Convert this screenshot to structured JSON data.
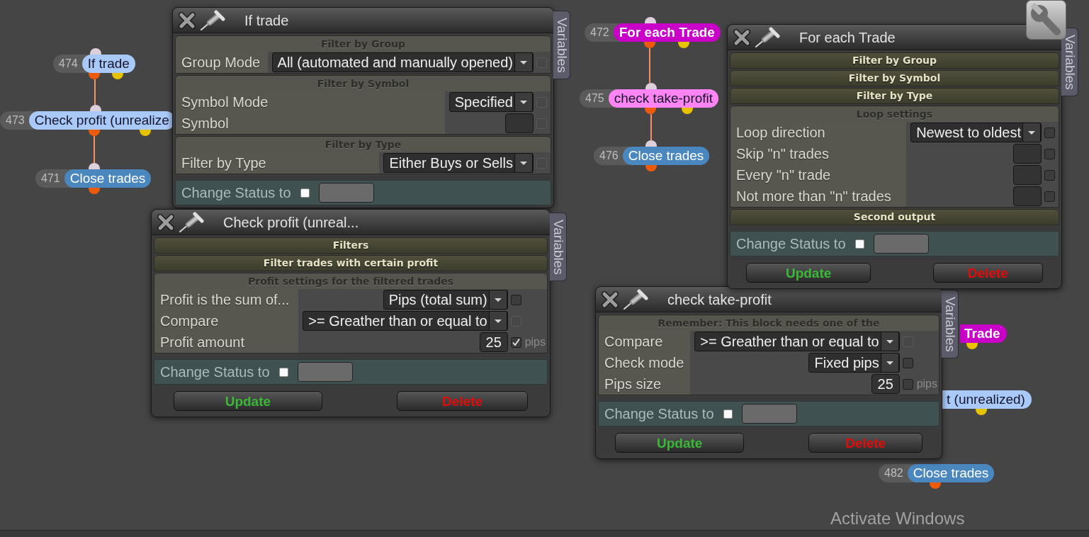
{
  "canvas": {
    "nodes": [
      {
        "number": "474",
        "label": "If trade",
        "kind": "condition",
        "color": "#a9c9f9",
        "input_port": true,
        "output_port": true,
        "second_output_port": true
      },
      {
        "number": "473",
        "label": "Check profit (unrealize",
        "kind": "condition",
        "color": "#a9c9f9",
        "input_port": true,
        "output_port": true,
        "second_output_port": true
      },
      {
        "number": "471",
        "label": "Close trades",
        "kind": "action",
        "color": "#4a87bf",
        "input_port": true,
        "output_port": true
      },
      {
        "number": "472",
        "label": "For each Trade",
        "kind": "loop",
        "color": "#c800c8",
        "input_port": true,
        "output_port": true,
        "second_output_port": true
      },
      {
        "number": "475",
        "label": "check take-profit",
        "kind": "condition",
        "color": "#ff85f5",
        "input_port": true,
        "output_port": true,
        "second_output_port": true
      },
      {
        "number": "476",
        "label": "Close trades",
        "kind": "action",
        "color": "#4a87bf",
        "input_port": true,
        "output_port": true
      },
      {
        "label": "Trade",
        "kind": "loop",
        "color": "#c800c8",
        "second_output_port": true
      },
      {
        "label": "t (unrealized)",
        "kind": "condition",
        "color": "#a9c9f9",
        "second_output_port": true
      },
      {
        "number": "482",
        "label": "Close trades",
        "kind": "action",
        "color": "#4a87bf",
        "output_port": true
      }
    ]
  },
  "panels": [
    {
      "title": "If trade",
      "variables_tab": "Variables",
      "sections": [
        {
          "title": "Filter by Group",
          "expanded": true,
          "rows": [
            {
              "label": "Group Mode",
              "kind": "select",
              "value": "All (automated and manually opened)",
              "checkbox": {
                "checked": false,
                "disabled": true
              }
            }
          ]
        },
        {
          "title": "Filter by Symbol",
          "expanded": true,
          "rows": [
            {
              "label": "Symbol Mode",
              "kind": "select",
              "value": "Specified",
              "checkbox": {
                "checked": false,
                "disabled": true
              }
            },
            {
              "label": "Symbol",
              "kind": "input",
              "checkbox": {
                "checked": false,
                "disabled": true
              }
            }
          ]
        },
        {
          "title": "Filter by Type",
          "expanded": true,
          "rows": [
            {
              "label": "Filter by Type",
              "kind": "select",
              "value": "Either Buys or Sells",
              "checkbox": {
                "checked": false,
                "disabled": true
              }
            }
          ]
        }
      ],
      "change_status": {
        "label": "Change Status to",
        "checked": false
      }
    },
    {
      "title": "Check profit (unreal...",
      "variables_tab": "Variables",
      "sections": [
        {
          "title": "Filters",
          "expanded": false
        },
        {
          "title": "Filter trades with certain profit",
          "expanded": false
        },
        {
          "title": "Profit settings for the filtered trades",
          "expanded": true,
          "rows": [
            {
              "label": "Profit is the sum of...",
              "kind": "select",
              "value": "Pips (total sum)",
              "checkbox": {
                "checked": false,
                "disabled": false
              }
            },
            {
              "label": "Compare",
              "kind": "select",
              "value": ">= Greather than or equal to",
              "checkbox": {
                "checked": false,
                "disabled": true
              }
            },
            {
              "label": "Profit amount",
              "kind": "input",
              "value": "25",
              "checkbox": {
                "checked": true,
                "disabled": false
              },
              "unit": "pips"
            }
          ]
        }
      ],
      "change_status": {
        "label": "Change Status to",
        "checked": false
      },
      "buttons": [
        {
          "label": "Update",
          "kind": "update"
        },
        {
          "label": "Delete",
          "kind": "delete"
        }
      ]
    },
    {
      "title": "For each Trade",
      "variables_tab": "Variables",
      "sections": [
        {
          "title": "Filter by Group",
          "expanded": false
        },
        {
          "title": "Filter by Symbol",
          "expanded": false
        },
        {
          "title": "Filter by Type",
          "expanded": false
        },
        {
          "title": "Loop settings",
          "expanded": true,
          "rows": [
            {
              "label": "Loop direction",
              "kind": "select",
              "value": "Newest to oldest",
              "checkbox": {
                "checked": false,
                "disabled": false
              }
            },
            {
              "label": "Skip \"n\" trades",
              "kind": "input",
              "checkbox": {
                "checked": false,
                "disabled": false
              }
            },
            {
              "label": "Every \"n\" trade",
              "kind": "input",
              "checkbox": {
                "checked": false,
                "disabled": false
              }
            },
            {
              "label": "Not more than \"n\" trades",
              "kind": "input",
              "checkbox": {
                "checked": false,
                "disabled": false
              }
            }
          ]
        },
        {
          "title": "Second output",
          "expanded": false
        }
      ],
      "change_status": {
        "label": "Change Status to",
        "checked": false
      },
      "buttons": [
        {
          "label": "Update",
          "kind": "update"
        },
        {
          "label": "Delete",
          "kind": "delete"
        }
      ]
    },
    {
      "title": "check take-profit",
      "variables_tab": "Variables",
      "sections": [
        {
          "title": "Remember: This block needs one of the",
          "expanded": true,
          "rows": [
            {
              "label": "Compare",
              "kind": "select",
              "value": ">= Greather than or equal to",
              "checkbox": {
                "checked": false,
                "disabled": true
              }
            },
            {
              "label": "Check mode",
              "kind": "select",
              "value": "Fixed pips",
              "checkbox": {
                "checked": false,
                "disabled": false
              }
            },
            {
              "label": "Pips size",
              "kind": "input",
              "value": "25",
              "checkbox": {
                "checked": false,
                "disabled": false
              },
              "unit": "pips"
            }
          ]
        }
      ],
      "change_status": {
        "label": "Change Status to",
        "checked": false
      },
      "buttons": [
        {
          "label": "Update",
          "kind": "update"
        },
        {
          "label": "Delete",
          "kind": "delete"
        }
      ]
    }
  ],
  "os_notice": {
    "text": "Activate Windows"
  }
}
